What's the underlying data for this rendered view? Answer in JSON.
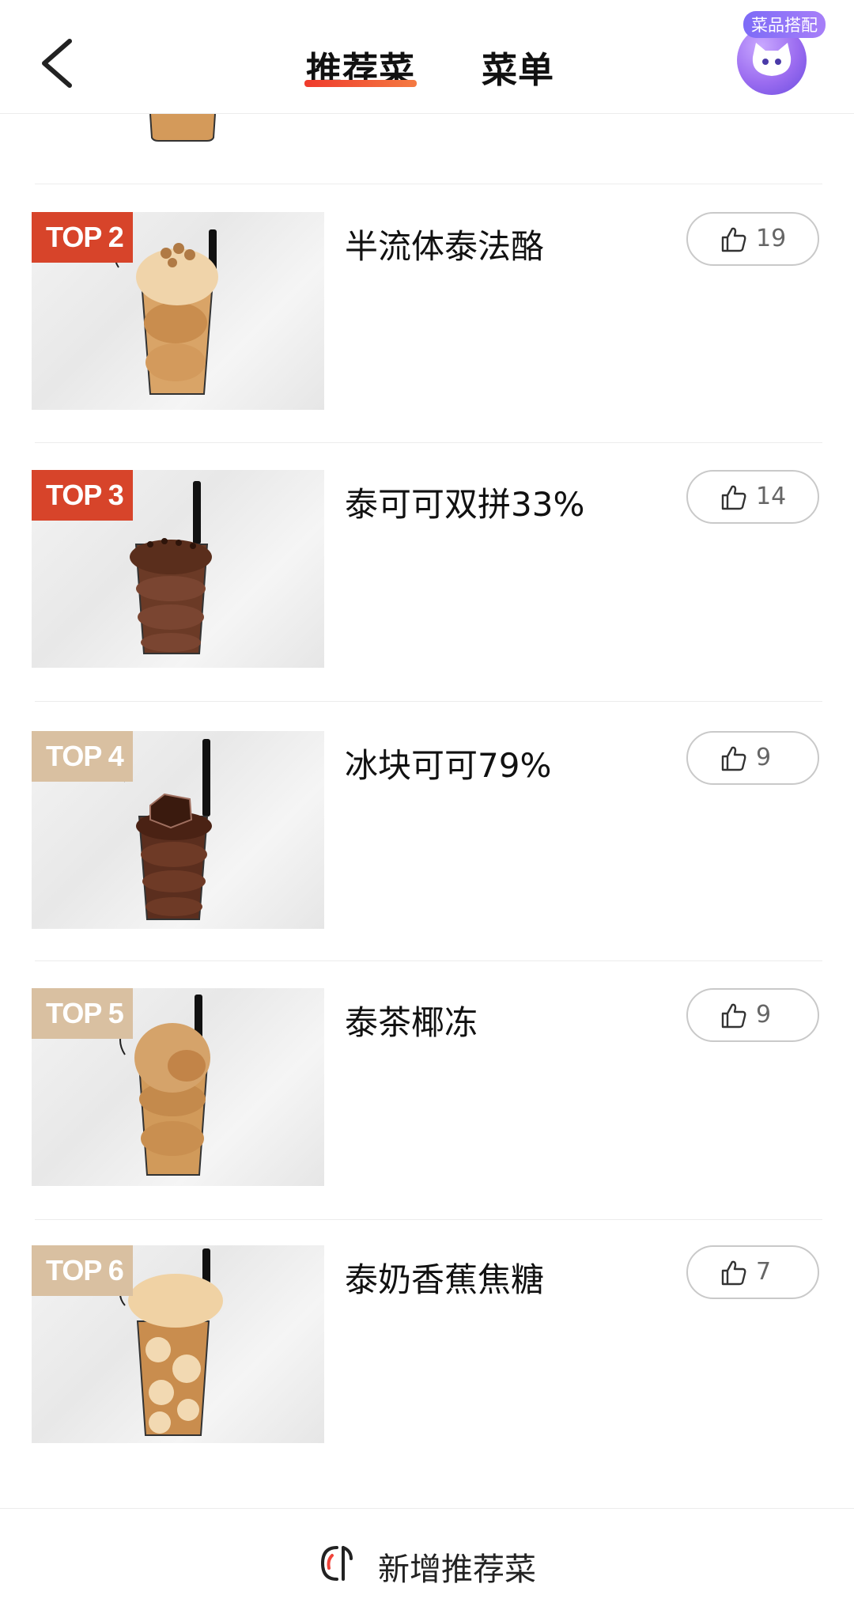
{
  "header": {
    "tabs": [
      {
        "label": "推荐菜",
        "active": true
      },
      {
        "label": "菜单",
        "active": false
      }
    ],
    "pairing_badge": "菜品搭配"
  },
  "items": [
    {
      "rank": "TOP 2",
      "name": "半流体泰法酪",
      "likes": "19",
      "badge_color": "#d7442a",
      "drink_color": "#d9a467"
    },
    {
      "rank": "TOP 3",
      "name": "泰可可双拼33%",
      "likes": "14",
      "badge_color": "#d7442a",
      "drink_color": "#6b3a26"
    },
    {
      "rank": "TOP 4",
      "name": "冰块可可79%",
      "likes": "9",
      "badge_color": "#d9c0a1",
      "drink_color": "#5b2e1e"
    },
    {
      "rank": "TOP 5",
      "name": "泰茶椰冻",
      "likes": "9",
      "badge_color": "#d9c0a1",
      "drink_color": "#d19a5a"
    },
    {
      "rank": "TOP 6",
      "name": "泰奶香蕉焦糖",
      "likes": "7",
      "badge_color": "#d9c0a1",
      "drink_color": "#c98d4e"
    }
  ],
  "footer": {
    "add_label": "新增推荐菜"
  }
}
